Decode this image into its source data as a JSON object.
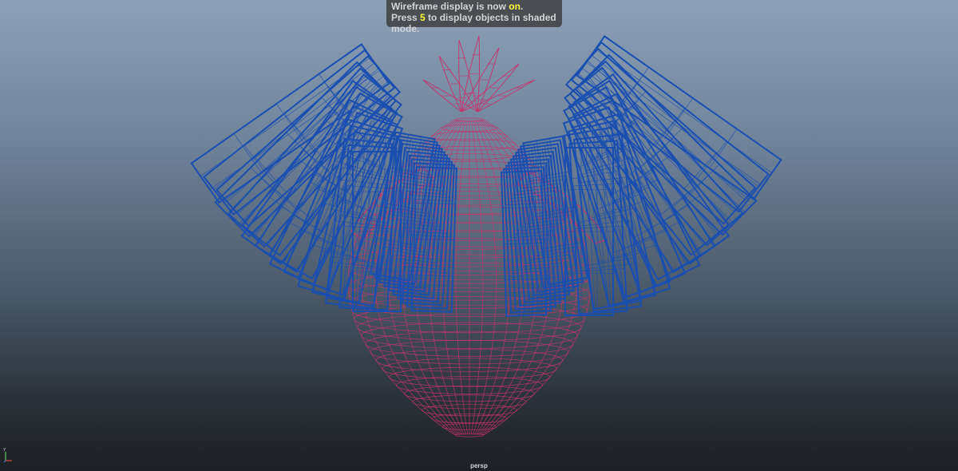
{
  "hud": {
    "line1_prefix": "Wireframe display is now ",
    "line1_state": "on",
    "line1_suffix": ".",
    "line2_prefix": "Press ",
    "line2_key": "5",
    "line2_suffix": " to display objects in shaded mode."
  },
  "viewport": {
    "camera": "persp",
    "axis_y": "Y",
    "colors": {
      "body_wire": "#c8336b",
      "wing_wire": "#1a4fb0",
      "highlight": "#ffff33"
    }
  }
}
